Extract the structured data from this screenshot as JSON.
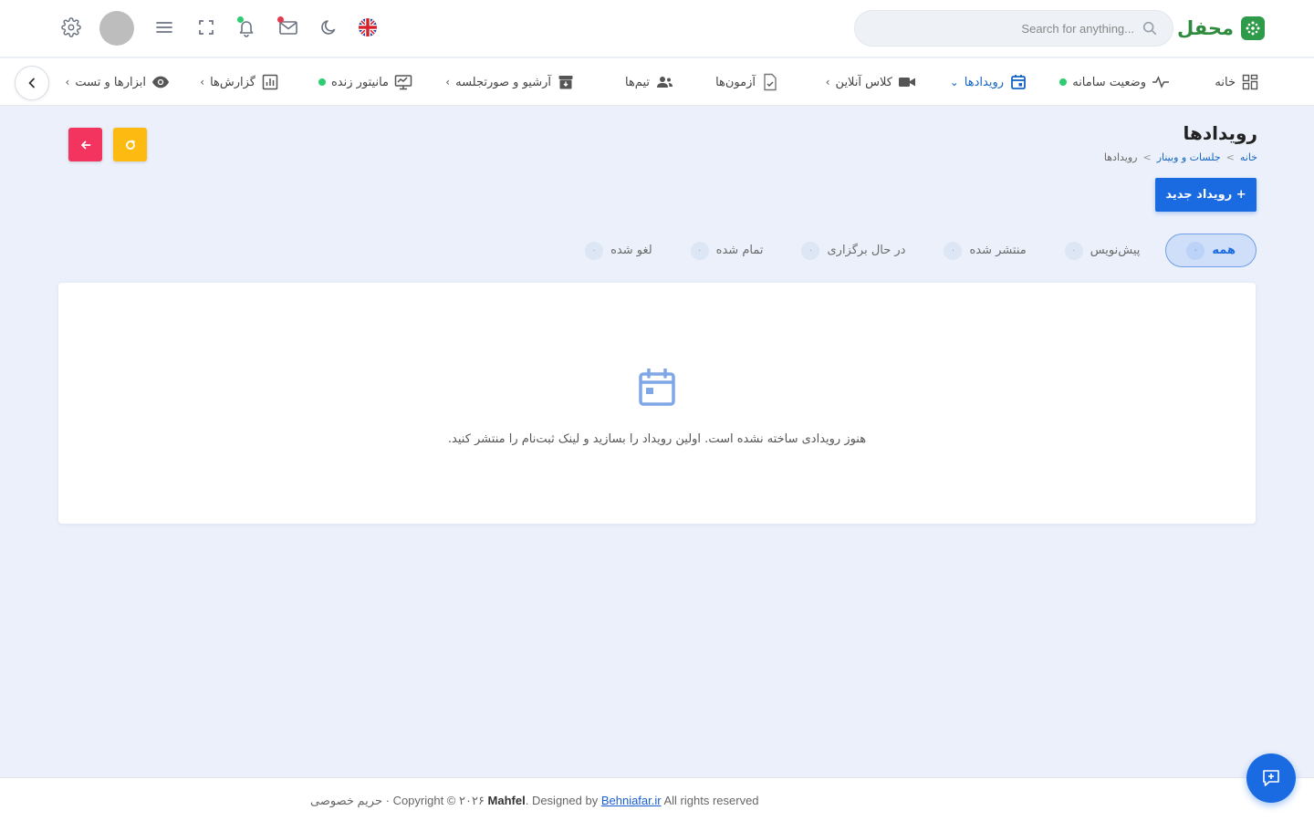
{
  "brand": {
    "name": "محفل",
    "color": "#2e8b3e"
  },
  "search": {
    "placeholder": "Search for anything..."
  },
  "header_icons": [
    "settings-icon",
    "avatar",
    "menu-icon",
    "fullscreen-icon",
    "bell-icon",
    "mail-icon",
    "moon-icon",
    "uk-flag-icon"
  ],
  "nav": {
    "items": [
      {
        "label": "خانه",
        "icon": "dashboard-icon"
      },
      {
        "label": "وضعیت سامانه",
        "icon": "pulse-icon",
        "live": true
      },
      {
        "label": "رویدادها",
        "icon": "calendar-icon",
        "active": true,
        "dropdown": true
      },
      {
        "label": "کلاس آنلاین",
        "icon": "video-icon",
        "submenu": true
      },
      {
        "label": "آزمون‌ها",
        "icon": "exam-icon"
      },
      {
        "label": "تیم‌ها",
        "icon": "team-icon"
      },
      {
        "label": "آرشیو و صورتجلسه",
        "icon": "archive-icon",
        "submenu": true
      },
      {
        "label": "مانیتور زنده",
        "icon": "monitor-icon",
        "live": true
      },
      {
        "label": "گزارش‌ها",
        "icon": "report-icon",
        "submenu": true
      },
      {
        "label": "ابزارها و تست",
        "icon": "eye-icon",
        "submenu": true
      }
    ]
  },
  "page": {
    "title": "رویدادها",
    "breadcrumb": {
      "home": "خانه",
      "section": "جلسات و وبینار",
      "current": "رویدادها",
      "separator": ">"
    },
    "new_button": "+ رویداد جدید"
  },
  "tabs": [
    {
      "label": "همه",
      "count": "۰",
      "active": true
    },
    {
      "label": "پیش‌نویس",
      "count": "۰"
    },
    {
      "label": "منتشر شده",
      "count": "۰"
    },
    {
      "label": "در حال برگزاری",
      "count": "۰"
    },
    {
      "label": "تمام شده",
      "count": "۰"
    },
    {
      "label": "لغو شده",
      "count": "۰"
    }
  ],
  "empty_state": {
    "message": "هنوز رویدادی ساخته نشده است. اولین رویداد را بسازید و لینک ثبت‌نام را منتشر کنید.",
    "icon": "calendar-icon"
  },
  "footer": {
    "privacy": "حریم خصوصی",
    "sep": " · ",
    "copyright": "Copyright © ۲۰۲۶ ",
    "brand": "Mahfel",
    "designed_by": ". Designed by ",
    "designer": "Behniafar.ir",
    "rights": " All rights reserved"
  },
  "colors": {
    "primary": "#1a6be2",
    "refresh": "#fdbb12",
    "back": "#f3345f",
    "live_dot": "#2ecc71",
    "background": "#ebf0fb"
  }
}
